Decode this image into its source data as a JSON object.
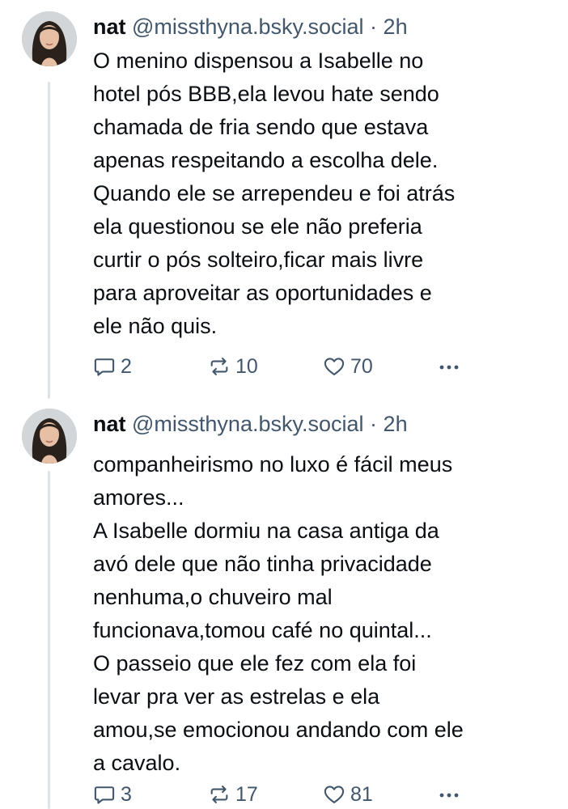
{
  "posts": [
    {
      "author": {
        "name": "nat",
        "handle": "@missthyna.bsky.social"
      },
      "separator": "·",
      "time": "2h",
      "text_lines": [
        "O menino dispensou a Isabelle no",
        "hotel pós BBB,ela levou hate sendo",
        "chamada de fria sendo que estava",
        "apenas respeitando a escolha dele.",
        "Quando ele se arrependeu e foi atrás",
        "ela questionou se ele não preferia",
        "curtir o pós solteiro,ficar mais livre",
        "para aproveitar as oportunidades e",
        "ele não quis."
      ],
      "stats": {
        "replies": "2",
        "reposts": "10",
        "likes": "70"
      }
    },
    {
      "author": {
        "name": "nat",
        "handle": "@missthyna.bsky.social"
      },
      "separator": "·",
      "time": "2h",
      "text_lines": [
        "companheirismo no luxo é fácil meus",
        "amores...",
        "A Isabelle dormiu na casa antiga da",
        "avó dele que não tinha privacidade",
        "nenhuma,o chuveiro mal",
        "funcionava,tomou café no quintal...",
        "O passeio que ele fez com ela foi",
        "levar pra ver as estrelas e ela",
        "amou,se emocionou andando com ele",
        "a cavalo."
      ],
      "stats": {
        "replies": "3",
        "reposts": "17",
        "likes": "81"
      }
    }
  ],
  "icons": {
    "reply": "speech-bubble-icon",
    "repost": "repost-arrows-icon",
    "like": "heart-outline-icon",
    "more": "ellipsis-icon"
  },
  "colors": {
    "text": "#0b0f14",
    "muted": "#42576c",
    "thread_line": "#dfe3e8"
  }
}
